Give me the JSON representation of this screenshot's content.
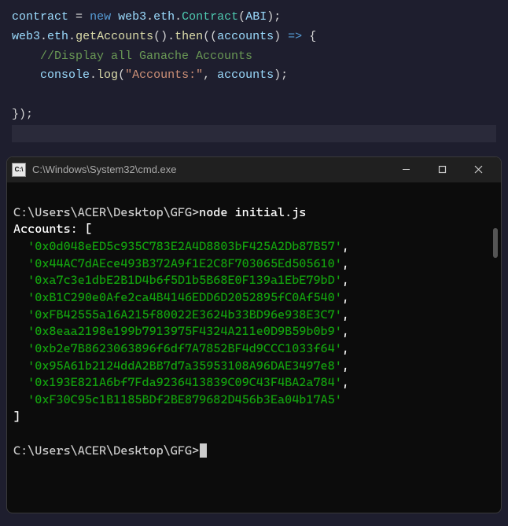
{
  "editor": {
    "lines": [
      {
        "segments": [
          {
            "text": "contract",
            "cls": "variable"
          },
          {
            "text": " ",
            "cls": "punct"
          },
          {
            "text": "=",
            "cls": "operator"
          },
          {
            "text": " ",
            "cls": "punct"
          },
          {
            "text": "new",
            "cls": "keyword"
          },
          {
            "text": " ",
            "cls": "punct"
          },
          {
            "text": "web3",
            "cls": "property"
          },
          {
            "text": ".",
            "cls": "punct"
          },
          {
            "text": "eth",
            "cls": "property"
          },
          {
            "text": ".",
            "cls": "punct"
          },
          {
            "text": "Contract",
            "cls": "class-name"
          },
          {
            "text": "(",
            "cls": "punct"
          },
          {
            "text": "ABI",
            "cls": "property"
          },
          {
            "text": ");",
            "cls": "punct"
          }
        ]
      },
      {
        "segments": [
          {
            "text": "web3",
            "cls": "property"
          },
          {
            "text": ".",
            "cls": "punct"
          },
          {
            "text": "eth",
            "cls": "property"
          },
          {
            "text": ".",
            "cls": "punct"
          },
          {
            "text": "getAccounts",
            "cls": "method"
          },
          {
            "text": "().",
            "cls": "punct"
          },
          {
            "text": "then",
            "cls": "method"
          },
          {
            "text": "((",
            "cls": "punct"
          },
          {
            "text": "accounts",
            "cls": "param"
          },
          {
            "text": ") ",
            "cls": "punct"
          },
          {
            "text": "=>",
            "cls": "keyword"
          },
          {
            "text": " {",
            "cls": "punct"
          }
        ]
      },
      {
        "segments": [
          {
            "text": "    ",
            "cls": "punct"
          },
          {
            "text": "//Display all Ganache Accounts",
            "cls": "comment"
          }
        ]
      },
      {
        "segments": [
          {
            "text": "    ",
            "cls": "punct"
          },
          {
            "text": "console",
            "cls": "property"
          },
          {
            "text": ".",
            "cls": "punct"
          },
          {
            "text": "log",
            "cls": "method"
          },
          {
            "text": "(",
            "cls": "punct"
          },
          {
            "text": "\"Accounts:\"",
            "cls": "string"
          },
          {
            "text": ", ",
            "cls": "punct"
          },
          {
            "text": "accounts",
            "cls": "property"
          },
          {
            "text": ");",
            "cls": "punct"
          }
        ]
      },
      {
        "segments": [
          {
            "text": " ",
            "cls": "punct"
          }
        ]
      },
      {
        "segments": [
          {
            "text": "});",
            "cls": "punct"
          }
        ]
      }
    ]
  },
  "terminal": {
    "title": "C:\\Windows\\System32\\cmd.exe",
    "icon_label": "C:\\",
    "prompt_path": "C:\\Users\\ACER\\Desktop\\GFG>",
    "command": "node initial.js",
    "output_header": "Accounts: ",
    "bracket_open": "[",
    "bracket_close": "]",
    "accounts": [
      "0x0d048eED5c935C783E2A4D8803bF425A2Db87B57",
      "0x44AC7dAEce493B372A9f1E2C8F703065Ed505610",
      "0xa7c3e1dbE2B1D4b6f5D1b5B68E0F139a1EbE79bD",
      "0xB1C290e0Afe2ca4B4146EDD6D2052895fC0Af540",
      "0xFB42555a16A215f80022E3624b33BD96e938E3C7",
      "0x8eaa2198e199b7913975F4324A211e0D9B59b0b9",
      "0xb2e7B8623063896f6df7A7852BF4d9CCC1033f64",
      "0x95A61b2124ddA2BB7d7a35953108A96DAE3497e8",
      "0x193E821A6bf7Fda9236413839C09C43F4BA2a784",
      "0xF30C95c1B1185BDf2BE879682D456b3Ea04b17A5"
    ]
  }
}
